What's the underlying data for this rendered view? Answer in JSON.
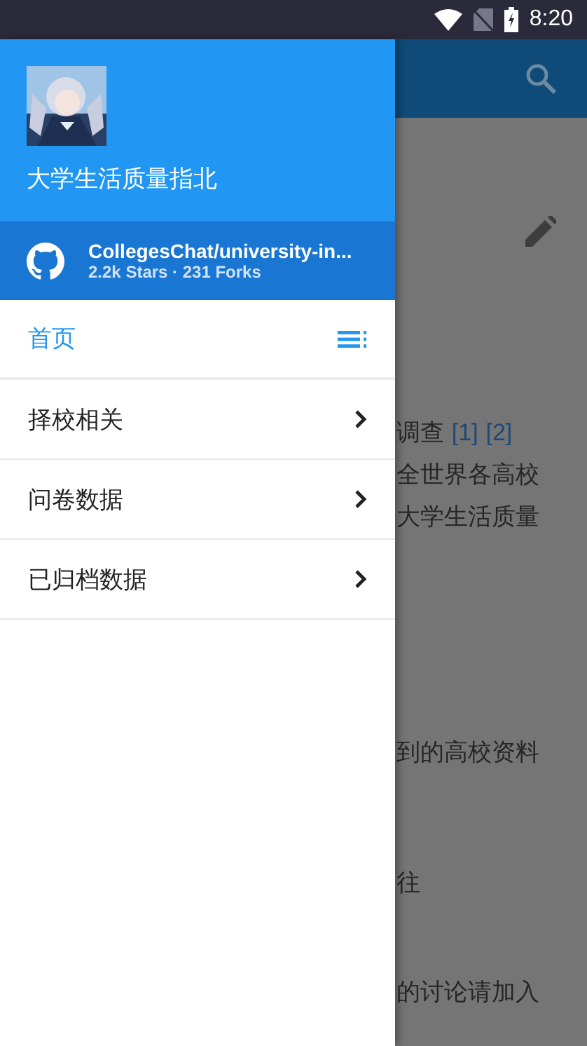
{
  "status_bar": {
    "time": "8:20"
  },
  "drawer": {
    "title": "大学生活质量指北",
    "repo": {
      "name": "CollegesChat/university-in...",
      "stats": "2.2k Stars · 231 Forks"
    },
    "items": [
      {
        "label": "首页",
        "selected": true
      },
      {
        "label": "择校相关",
        "selected": false
      },
      {
        "label": "问卷数据",
        "selected": false
      },
      {
        "label": "已归档数据",
        "selected": false
      }
    ]
  },
  "content": {
    "paragraphs": [
      {
        "lines": [
          {
            "text": "调查",
            "refs": [
              "[1]",
              "[2]"
            ]
          },
          {
            "text": "全世界各高校"
          },
          {
            "text": "大学生活质量"
          }
        ]
      },
      {
        "lines": [
          {
            "text": "到的高校资料"
          }
        ]
      },
      {
        "lines": [
          {
            "text": "往"
          }
        ]
      },
      {
        "lines": [
          {
            "text": "的讨论请加入"
          }
        ]
      }
    ]
  }
}
